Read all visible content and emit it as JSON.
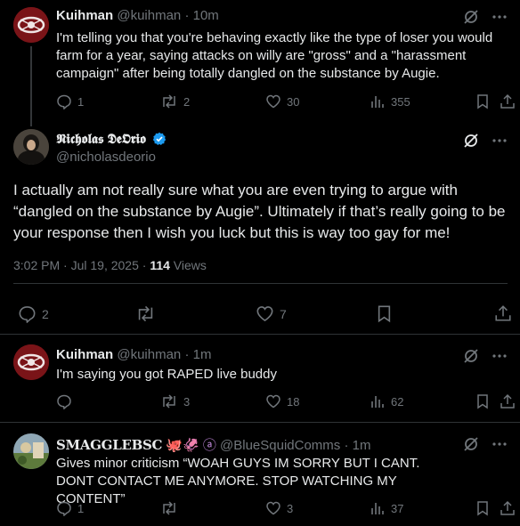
{
  "posts": [
    {
      "display_name": "Kuihman",
      "handle": "@kuihman",
      "time": "· 10m",
      "text": "I'm telling you that you're behaving exactly like the type of loser you would farm for a year, saying attacks on willy are \"gross\" and a \"harassment campaign\" after being totally dangled on the substance by Augie.",
      "replies": "1",
      "reposts": "2",
      "likes": "30",
      "views": "355"
    },
    {
      "display_name": "𝕹𝖎𝖈𝖍𝖔𝖑𝖆𝖘 𝕯𝖊𝕺𝖗𝖎𝖔",
      "handle": "@nicholasdeorio",
      "text": "I actually am not really sure what you are even trying to argue with “dangled on the substance by Augie”. Ultimately if that’s really going to be your response then I wish you luck but this is way too gay for me!",
      "timestamp": "3:02 PM · Jul 19, 2025 ·",
      "view_count": "114",
      "views_label": "Views",
      "replies": "2",
      "reposts": "",
      "likes": "7"
    },
    {
      "display_name": "Kuihman",
      "handle": "@kuihman",
      "time": "· 1m",
      "text": "I'm saying you got RAPED live buddy",
      "replies": "",
      "reposts": "3",
      "likes": "18",
      "views": "62"
    },
    {
      "display_name": "SMAGGLEBSC",
      "name_emoji": "🐙🦑 ⓐ",
      "handle": "@BlueSquidComms",
      "time": "· 1m",
      "text": "Gives minor criticism “WOAH GUYS IM SORRY BUT I CANT. DONT CONTACT ME ANYMORE. STOP WATCHING MY CONTENT”",
      "replies": "1",
      "reposts": "",
      "likes": "3",
      "views": "37"
    }
  ],
  "colors": {
    "background": "#000000",
    "text": "#e7e9ea",
    "muted": "#71767b",
    "verified": "#1d9bf0",
    "divider": "#2f3336"
  }
}
